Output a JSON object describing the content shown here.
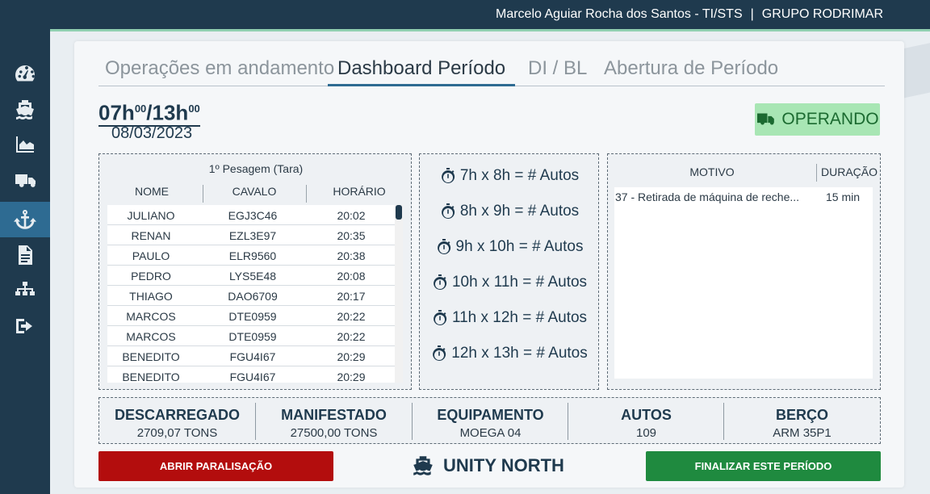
{
  "header": {
    "user": "Marcelo Aguiar Rocha dos Santos - TI/STS",
    "separator": "|",
    "company": "GRUPO RODRIMAR"
  },
  "sidebar": {
    "items": [
      {
        "icon": "dashboard-gauge-icon"
      },
      {
        "icon": "ship-icon"
      },
      {
        "icon": "area-chart-icon"
      },
      {
        "icon": "truck-icon"
      },
      {
        "icon": "anchor-icon",
        "active": true
      },
      {
        "icon": "document-icon"
      },
      {
        "icon": "sitemap-icon"
      },
      {
        "icon": "logout-icon"
      }
    ]
  },
  "tabs": [
    {
      "label": "Operações em andamento"
    },
    {
      "label": "Dashboard Período",
      "active": true
    },
    {
      "label": "DI / BL"
    },
    {
      "label": "Abertura de Período"
    }
  ],
  "period": {
    "start": "07h",
    "start_sup": "00",
    "sep": "/",
    "end": "13h",
    "end_sup": "00",
    "date": "08/03/2023"
  },
  "status": {
    "label": "OPERANDO",
    "icon": "truck-icon",
    "color": "#1b6a30",
    "bg": "#a8e6b4"
  },
  "weighing": {
    "title": "1º Pesagem (Tara)",
    "columns": [
      "NOME",
      "CAVALO",
      "HORÁRIO"
    ],
    "rows": [
      [
        "JULIANO",
        "EGJ3C46",
        "20:02"
      ],
      [
        "RENAN",
        "EZL3E97",
        "20:35"
      ],
      [
        "PAULO",
        "ELR9560",
        "20:38"
      ],
      [
        "PEDRO",
        "LYS5E48",
        "20:08"
      ],
      [
        "THIAGO",
        "DAO6709",
        "20:17"
      ],
      [
        "MARCOS",
        "DTE0959",
        "20:22"
      ],
      [
        "MARCOS",
        "DTE0959",
        "20:22"
      ],
      [
        "BENEDITO",
        "FGU4I67",
        "20:29"
      ],
      [
        "BENEDITO",
        "FGU4I67",
        "20:29"
      ]
    ]
  },
  "autos_per_hour": [
    {
      "label": "7h x 8h = # Autos"
    },
    {
      "label": "8h x 9h = # Autos"
    },
    {
      "label": "9h x 10h = # Autos"
    },
    {
      "label": "10h x 11h = # Autos"
    },
    {
      "label": "11h x 12h = # Autos"
    },
    {
      "label": "12h x 13h = # Autos"
    }
  ],
  "stoppages": {
    "columns": [
      "MOTIVO",
      "DURAÇÃO"
    ],
    "rows": [
      {
        "motivo": "37 - Retirada de máquina de reche...",
        "duracao": "15 min"
      }
    ]
  },
  "stats": [
    {
      "label": "DESCARREGADO",
      "value": "2709,07 TONS"
    },
    {
      "label": "MANIFESTADO",
      "value": "27500,00 TONS"
    },
    {
      "label": "EQUIPAMENTO",
      "value": "MOEGA 04"
    },
    {
      "label": "AUTOS",
      "value": "109"
    },
    {
      "label": "BERÇO",
      "value": "ARM 35P1"
    }
  ],
  "actions": {
    "open_stoppage": "ABRIR PARALISAÇÃO",
    "ship_name": "UNITY NORTH",
    "finish_period": "FINALIZAR ESTE PERÍODO"
  },
  "colors": {
    "navy": "#1f3a4e",
    "sidebar_active": "#2e6b92",
    "danger": "#b30d0d",
    "success": "#1f8a3f"
  }
}
